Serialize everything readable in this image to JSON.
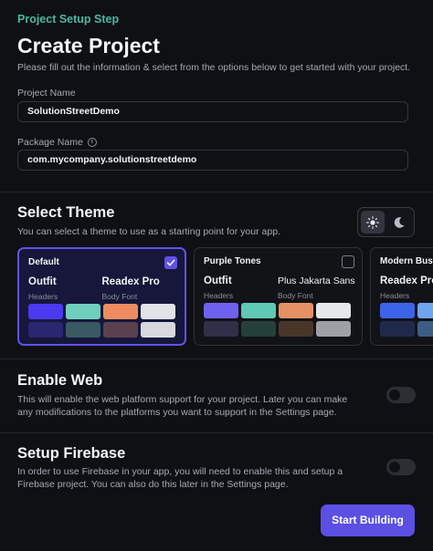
{
  "header": {
    "step": "Project Setup Step",
    "title": "Create Project",
    "subtitle": "Please fill out the information & select from the options below to get started with your project."
  },
  "form": {
    "project_name_label": "Project Name",
    "project_name_value": "SolutionStreetDemo",
    "package_name_label": "Package Name",
    "package_name_value": "com.mycompany.solutionstreetdemo"
  },
  "theme_section": {
    "title": "Select Theme",
    "description": "You can select a theme to use as a starting point for your app.",
    "mode": "light",
    "themes": [
      {
        "name": "Default",
        "selected": true,
        "header_font": "Outfit",
        "body_font": "Readex Pro",
        "header_role": "Headers",
        "body_role": "Body Font",
        "swatches": [
          "#4b39ef",
          "#6fcfbd",
          "#ee8b60",
          "#e0e3e7",
          "#2a2670",
          "#3a5a63",
          "#5b4150",
          "#d7d8de"
        ]
      },
      {
        "name": "Purple Tones",
        "selected": false,
        "header_font": "Outfit",
        "body_font": "Plus Jakarta Sans",
        "header_role": "Headers",
        "body_role": "Body Font",
        "swatches": [
          "#6f61ef",
          "#5fc9b3",
          "#e59065",
          "#e5e7eb",
          "#302f48",
          "#254038",
          "#4a3628",
          "#9ea0a6"
        ]
      },
      {
        "name": "Modern Busin",
        "selected": false,
        "header_font": "Readex Pro",
        "body_font": "",
        "header_role": "Headers",
        "body_role": "",
        "swatches": [
          "#3d63e8",
          "#6fa5ee",
          "",
          "",
          "#1f2a4b",
          "#3e5d85",
          "",
          ""
        ]
      }
    ]
  },
  "web_section": {
    "title": "Enable Web",
    "description": "This will enable the web platform support for your project. Later you can make any modifications to the platforms you want to support in the Settings page.",
    "enabled": false
  },
  "firebase_section": {
    "title": "Setup Firebase",
    "description": "In order to use Firebase in your app, you will need to enable this and setup a Firebase project. You can also do this later in the Settings page.",
    "enabled": false
  },
  "footer": {
    "start_label": "Start Building"
  },
  "colors": {
    "accent": "#5b4fe4",
    "step_label": "#4ab8a1",
    "background": "#0f1013"
  }
}
